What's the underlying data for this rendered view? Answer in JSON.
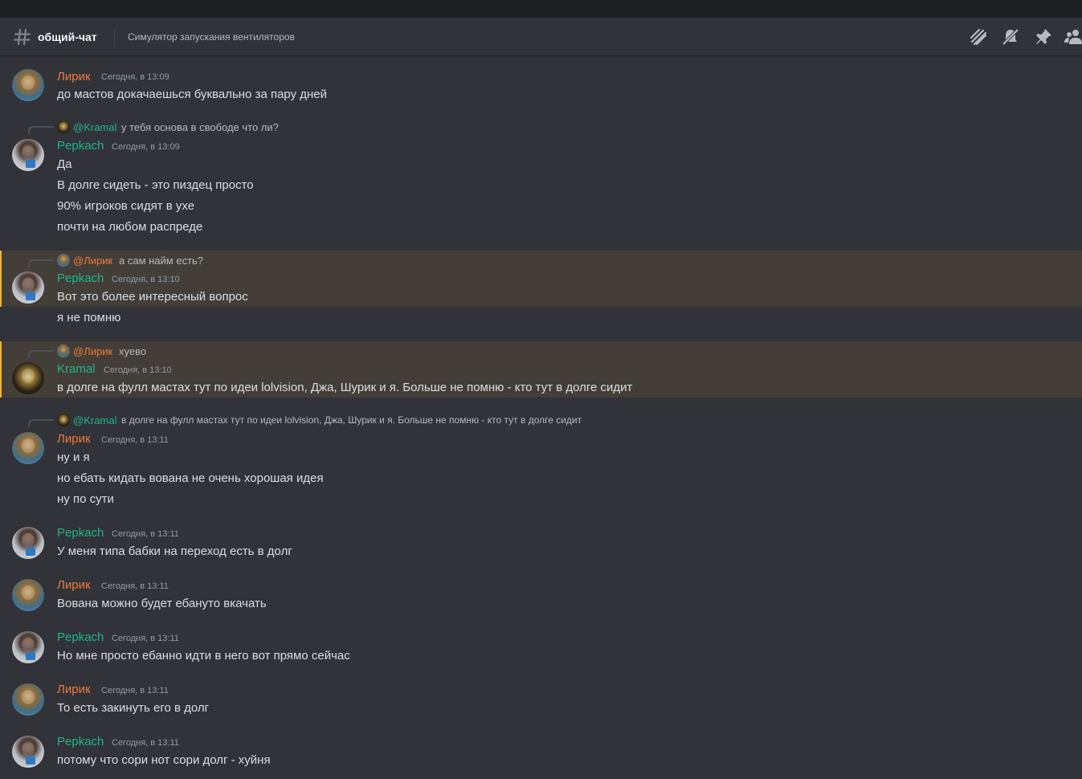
{
  "header": {
    "channel_name": "общий-чат",
    "topic": "Симулятор запускания вентиляторов",
    "icons": [
      "threads-icon",
      "notifications-muted-icon",
      "pin-icon",
      "members-icon"
    ]
  },
  "colors": {
    "background": "#313338",
    "highlight_bg": "#433f38",
    "highlight_bar": "#f0b232",
    "lirik_name": "#f3793b",
    "pepkach_name": "#1fb48c",
    "kramal_name": "#1fb48c",
    "timestamp": "#949ba4"
  },
  "messages": [
    {
      "author": "Лирик",
      "timestamp": "Сегодня, в 13:09",
      "lines": [
        "до мастов докачаешься буквально за пару дней"
      ]
    },
    {
      "reply": {
        "mention": "@Kramal",
        "text": "у тебя основа в свободе что ли?"
      },
      "author": "Pepkach",
      "timestamp": "Сегодня, в 13:09",
      "lines": [
        "Да",
        "В долге сидеть - это пиздец просто",
        "90% игроков сидят в ухе",
        "почти на любом распреде"
      ]
    },
    {
      "reply": {
        "mention": "@Лирик",
        "text": "а сам найм есть?"
      },
      "author": "Pepkach",
      "timestamp": "Сегодня, в 13:10",
      "lines": [
        "Вот это более интересный вопрос",
        "я не помню"
      ]
    },
    {
      "reply": {
        "mention": "@Лирик",
        "text": "хуево"
      },
      "author": "Kramal",
      "timestamp": "Сегодня, в 13:10",
      "lines": [
        "в долге на фулл мастах тут по идеи lolvision, Джа, Шурик и я. Больше не помню - кто тут в долге сидит"
      ]
    },
    {
      "reply": {
        "mention": "@Kramal",
        "text": "в долге на фулл мастах тут по идеи lolvision, Джа, Шурик и я. Больше не помню - кто тут в долге сидит"
      },
      "author": "Лирик",
      "timestamp": "Сегодня, в 13:11",
      "lines": [
        "ну и я",
        "но ебать кидать вована не очень хорошая идея",
        "ну по сути"
      ]
    },
    {
      "author": "Pepkach",
      "timestamp": "Сегодня, в 13:11",
      "lines": [
        "У меня типа бабки на переход есть в долг"
      ]
    },
    {
      "author": "Лирик",
      "timestamp": "Сегодня, в 13:11",
      "lines": [
        "Вована можно будет ебануто вкачать"
      ]
    },
    {
      "author": "Pepkach",
      "timestamp": "Сегодня, в 13:11",
      "lines": [
        "Но мне просто ебанно идти в него вот прямо сейчас"
      ]
    },
    {
      "author": "Лирик",
      "timestamp": "Сегодня, в 13:11",
      "lines": [
        "То есть закинуть его в долг"
      ]
    },
    {
      "author": "Pepkach",
      "timestamp": "Сегодня, в 13:11",
      "lines": [
        "потому что сори нот сори долг - хуйня"
      ]
    }
  ]
}
